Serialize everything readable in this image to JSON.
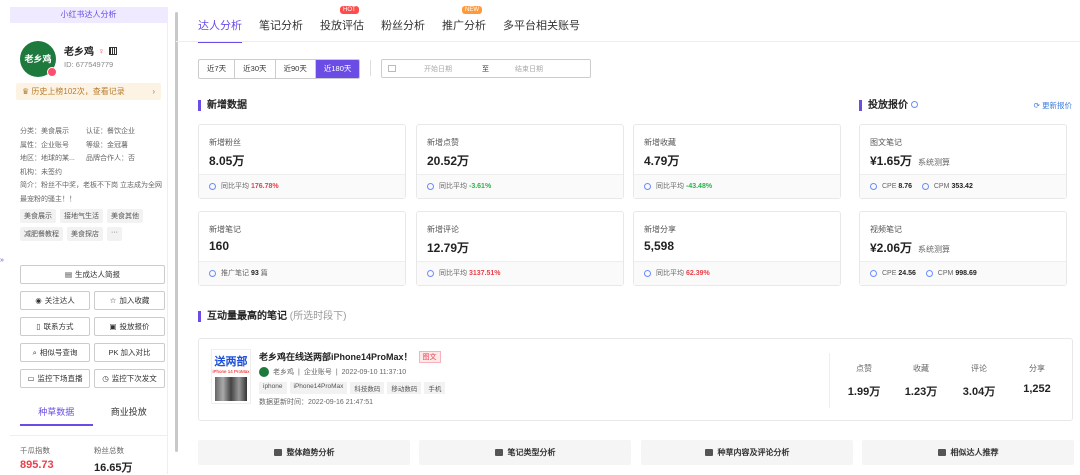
{
  "sidebar": {
    "header": "小红书达人分析",
    "avatar_text": "老乡鸡",
    "name": "老乡鸡",
    "id_label": "ID:",
    "id": "677549779",
    "history": "历史上榜102次，查看记录",
    "info": [
      [
        "分类：美食展示",
        "认证：餐饮企业"
      ],
      [
        "属性：企业账号",
        "等级：金冠薯"
      ],
      [
        "地区：地球的某...",
        "品牌合作人：否"
      ],
      [
        "机构：未签约",
        ""
      ]
    ],
    "intro": "简介：粉丝不中奖，老板不下岗 立志成为全网最宠粉的骚主！！",
    "tags": [
      "美食展示",
      "接地气生活",
      "美食其他",
      "减肥餐教程",
      "美食探店",
      "···"
    ],
    "buttons": {
      "report": "生成达人简报",
      "follow": "关注达人",
      "favorite": "加入收藏",
      "contact": "联系方式",
      "quote": "投放报价",
      "similar": "相似号查询",
      "compare": "PK 加入对比",
      "monitor_live": "监控下场直播",
      "monitor_post": "监控下次发文"
    },
    "tabs": [
      "种草数据",
      "商业投放"
    ],
    "stats": [
      {
        "label": "千瓜指数",
        "value": "895.73"
      },
      {
        "label": "粉丝总数",
        "value": "16.65万"
      }
    ],
    "collapse": "»"
  },
  "main": {
    "tabs": [
      {
        "label": "达人分析",
        "badge": ""
      },
      {
        "label": "笔记分析",
        "badge": ""
      },
      {
        "label": "投放评估",
        "badge": "HOT"
      },
      {
        "label": "粉丝分析",
        "badge": ""
      },
      {
        "label": "推广分析",
        "badge": "NEW"
      },
      {
        "label": "多平台相关账号",
        "badge": ""
      }
    ],
    "ranges": [
      "近7天",
      "近30天",
      "近90天",
      "近180天"
    ],
    "date_start": "开始日期",
    "date_to": "至",
    "date_end": "结束日期",
    "new_data_title": "新增数据",
    "cards": [
      {
        "label": "新增粉丝",
        "value": "8.05万",
        "foot_label": "同比平均",
        "foot_value": "176.78%",
        "foot_color": "red"
      },
      {
        "label": "新增点赞",
        "value": "20.52万",
        "foot_label": "同比平均",
        "foot_value": "-3.61%",
        "foot_color": "green"
      },
      {
        "label": "新增收藏",
        "value": "4.79万",
        "foot_label": "同比平均",
        "foot_value": "-43.48%",
        "foot_color": "green"
      },
      {
        "label": "新增笔记",
        "value": "160",
        "foot_label": "推广笔记",
        "foot_value": "93",
        "foot_suffix": "篇",
        "foot_color": "dark"
      },
      {
        "label": "新增评论",
        "value": "12.79万",
        "foot_label": "同比平均",
        "foot_value": "3137.51%",
        "foot_color": "red"
      },
      {
        "label": "新增分享",
        "value": "5,598",
        "foot_label": "同比平均",
        "foot_value": "62.39%",
        "foot_color": "red"
      }
    ],
    "quote_title": "投放报价",
    "update_quote": "更新报价",
    "quotes": [
      {
        "label": "图文笔记",
        "value": "¥1.65万",
        "unit": "系统测算",
        "cpe_label": "CPE",
        "cpe": "8.76",
        "cpm_label": "CPM",
        "cpm": "353.42"
      },
      {
        "label": "视频笔记",
        "value": "¥2.06万",
        "unit": "系统测算",
        "cpe_label": "CPE",
        "cpe": "24.56",
        "cpm_label": "CPM",
        "cpm": "998.69"
      }
    ],
    "top_note_title": "互动量最高的笔记",
    "top_note_sub": "(所选时段下)",
    "note": {
      "thumb_title": "送两部",
      "thumb_sub": "iPhone 14 ProMax",
      "title": "老乡鸡在线送两部iPhone14ProMax！",
      "type": "图文",
      "author": "老乡鸡",
      "account_type": "企业账号",
      "time": "2022-09-10 11:37:10",
      "tags": [
        "iphone",
        "iPhone14ProMax",
        "科技数码",
        "移动数码",
        "手机"
      ],
      "updated": "数据更新时间：2022-09-16 21:47:51",
      "stats": [
        {
          "label": "点赞",
          "value": "1.99万"
        },
        {
          "label": "收藏",
          "value": "1.23万"
        },
        {
          "label": "评论",
          "value": "3.04万"
        },
        {
          "label": "分享",
          "value": "1,252"
        }
      ]
    },
    "bottom_buttons": [
      "整体趋势分析",
      "笔记类型分析",
      "种草内容及评论分析",
      "相似达人推荐"
    ]
  }
}
